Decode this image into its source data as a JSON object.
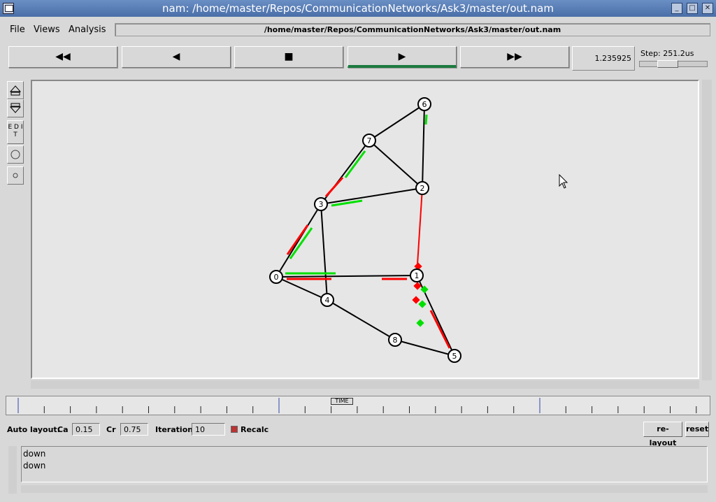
{
  "window": {
    "title": "nam: /home/master/Repos/CommunicationNetworks/Ask3/master/out.nam"
  },
  "menu": {
    "file": "File",
    "views": "Views",
    "analysis": "Analysis",
    "path": "/home/master/Repos/CommunicationNetworks/Ask3/master/out.nam"
  },
  "controls": {
    "rewind": "◀◀",
    "back": "◀",
    "stop": "■",
    "play": "▶",
    "fast_forward": "▶▶",
    "time": "1.235925",
    "step_label": "Step: 251.2us"
  },
  "tools": {
    "edit": "E D I T"
  },
  "network": {
    "nodes": [
      "0",
      "1",
      "2",
      "3",
      "4",
      "5",
      "6",
      "7",
      "8"
    ],
    "links": [
      [
        "0",
        "1"
      ],
      [
        "0",
        "3"
      ],
      [
        "0",
        "4"
      ],
      [
        "1",
        "2"
      ],
      [
        "1",
        "4"
      ],
      [
        "1",
        "5"
      ],
      [
        "2",
        "3"
      ],
      [
        "2",
        "6"
      ],
      [
        "2",
        "7"
      ],
      [
        "3",
        "4"
      ],
      [
        "3",
        "7"
      ],
      [
        "4",
        "8"
      ],
      [
        "5",
        "8"
      ],
      [
        "6",
        "7"
      ]
    ]
  },
  "timeline": {
    "label": "TIME"
  },
  "autolayout": {
    "label": "Auto layout:",
    "ca_label": "Ca",
    "ca": "0.15",
    "cr_label": "Cr",
    "cr": "0.75",
    "iter_label": "Iterations",
    "iterations": "10",
    "recalc": "Recalc",
    "relayout": "re-layout",
    "reset": "reset"
  },
  "console": {
    "lines": [
      "down",
      "down"
    ]
  },
  "colors": {
    "red": "#ff0000",
    "green": "#00e000",
    "title": "#5a7fb8"
  }
}
